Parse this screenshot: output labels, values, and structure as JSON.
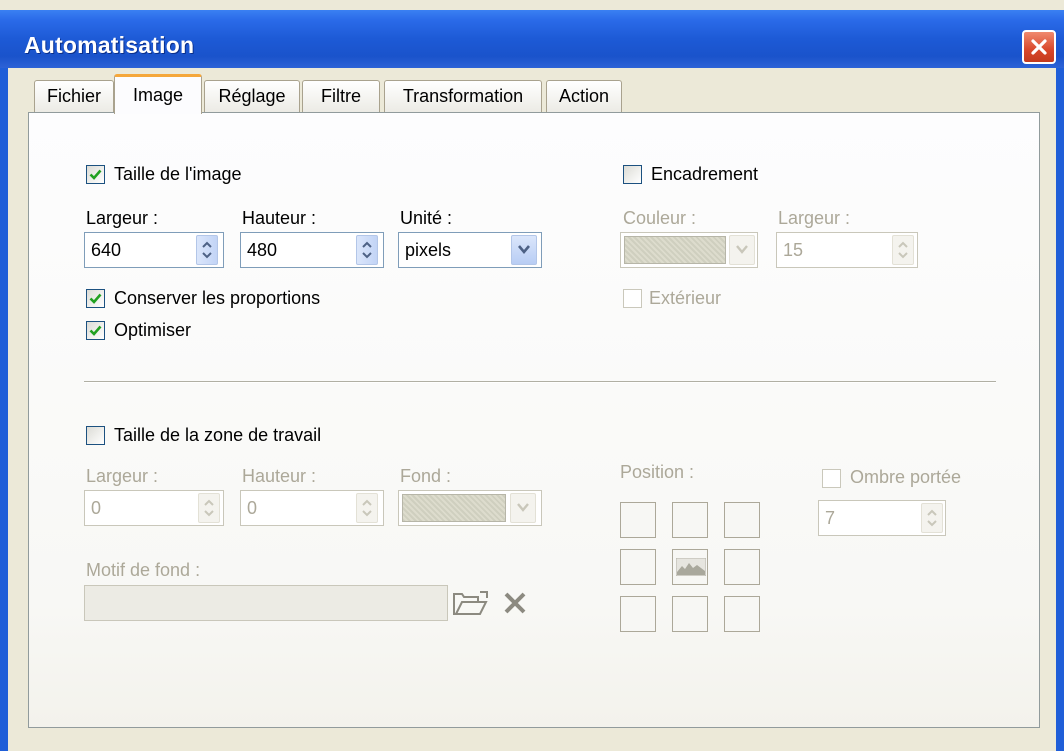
{
  "window": {
    "title": "Automatisation"
  },
  "tabs": [
    {
      "label": "Fichier"
    },
    {
      "label": "Image"
    },
    {
      "label": "Réglage"
    },
    {
      "label": "Filtre"
    },
    {
      "label": "Transformation"
    },
    {
      "label": "Action"
    }
  ],
  "image_size": {
    "checkbox_label": "Taille de l'image",
    "checked": true,
    "width_label": "Largeur :",
    "width_value": "640",
    "height_label": "Hauteur :",
    "height_value": "480",
    "unit_label": "Unité :",
    "unit_value": "pixels",
    "keep_ratio_label": "Conserver les proportions",
    "keep_ratio_checked": true,
    "optimize_label": "Optimiser",
    "optimize_checked": true
  },
  "frame": {
    "checkbox_label": "Encadrement",
    "checked": false,
    "color_label": "Couleur :",
    "width_label": "Largeur :",
    "width_value": "15",
    "outside_label": "Extérieur",
    "outside_checked": false
  },
  "canvas": {
    "checkbox_label": "Taille de la zone de travail",
    "checked": false,
    "width_label": "Largeur :",
    "width_value": "0",
    "height_label": "Hauteur :",
    "height_value": "0",
    "background_label": "Fond :",
    "pattern_label": "Motif de fond :",
    "pattern_value": "",
    "position_label": "Position :",
    "shadow_label": "Ombre portée",
    "shadow_checked": false,
    "shadow_value": "7"
  },
  "icons": {
    "close": "close-icon",
    "open_folder": "folder-open-icon",
    "delete": "x-icon",
    "position_center": "landscape-image-icon"
  }
}
